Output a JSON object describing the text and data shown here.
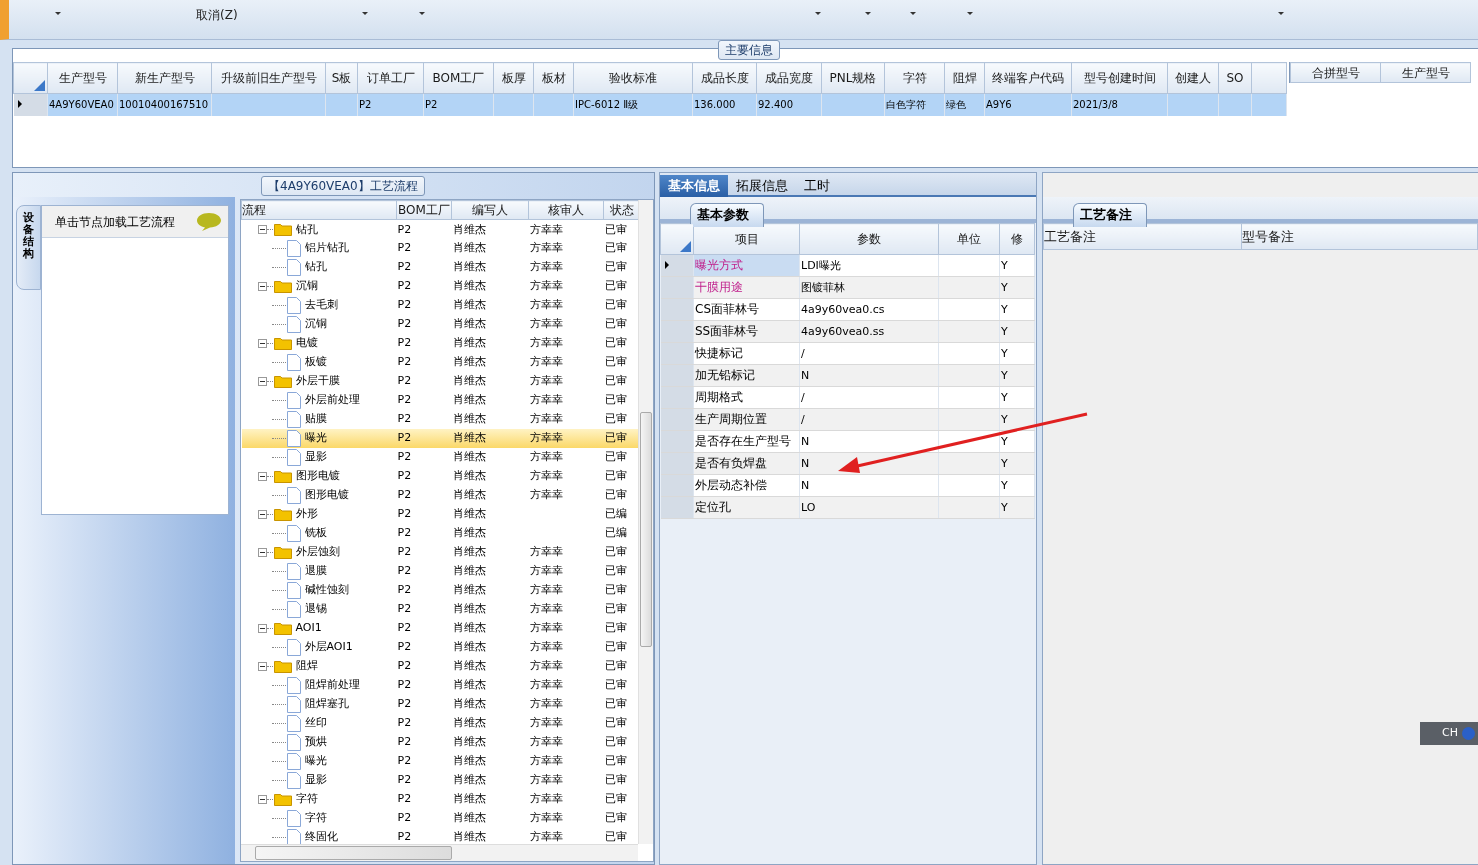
{
  "toolbar": {
    "items": [
      {
        "kind": "dropdown"
      },
      {
        "kind": "label",
        "text": "取消(Z)"
      },
      {
        "kind": "dropdown"
      },
      {
        "kind": "dropdown"
      },
      {
        "kind": "dropdown"
      },
      {
        "kind": "dropdown"
      },
      {
        "kind": "dropdown"
      },
      {
        "kind": "dropdown"
      },
      {
        "kind": "dropdown"
      }
    ]
  },
  "main_info": {
    "title": "主要信息",
    "columns": [
      "生产型号",
      "新生产型号",
      "升级前旧生产型号",
      "S板",
      "订单工厂",
      "BOM工厂",
      "板厚",
      "板材",
      "验收标准",
      "成品长度",
      "成品宽度",
      "PNL规格",
      "字符",
      "阻焊",
      "终端客户代码",
      "型号创建时间",
      "创建人",
      "SO"
    ],
    "rows": [
      {
        "selected": true,
        "cells": [
          "4A9Y60VEA0",
          "10010400167510",
          null,
          null,
          "P2",
          "P2",
          null,
          null,
          "IPC-6012 Ⅱ级",
          "136.000",
          "92.400",
          null,
          "白色字符",
          "绿色",
          "A9Y6",
          "2021/3/8",
          null,
          null
        ]
      }
    ],
    "merge_table": {
      "columns": [
        "合拼型号",
        "生产型号"
      ]
    }
  },
  "process": {
    "title": "【4A9Y60VEA0】工艺流程",
    "side_tab": "设备结构",
    "hint": "单击节点加载工艺流程",
    "columns": [
      "流程",
      "BOM工厂",
      "编写人",
      "核审人",
      "状态"
    ],
    "tree": [
      {
        "name": "钻孔",
        "factory": "P2",
        "writer": "肖维杰",
        "reviewer": "方幸幸",
        "status": "已审",
        "expanded": true,
        "selected": false,
        "children": [
          {
            "name": "铝片钻孔",
            "factory": "P2",
            "writer": "肖维杰",
            "reviewer": "方幸幸",
            "status": "已审",
            "selected": false
          },
          {
            "name": "钻孔",
            "factory": "P2",
            "writer": "肖维杰",
            "reviewer": "方幸幸",
            "status": "已审",
            "selected": false
          }
        ]
      },
      {
        "name": "沉铜",
        "factory": "P2",
        "writer": "肖维杰",
        "reviewer": "方幸幸",
        "status": "已审",
        "expanded": true,
        "selected": false,
        "children": [
          {
            "name": "去毛刺",
            "factory": "P2",
            "writer": "肖维杰",
            "reviewer": "方幸幸",
            "status": "已审",
            "selected": false
          },
          {
            "name": "沉铜",
            "factory": "P2",
            "writer": "肖维杰",
            "reviewer": "方幸幸",
            "status": "已审",
            "selected": false
          }
        ]
      },
      {
        "name": "电镀",
        "factory": "P2",
        "writer": "肖维杰",
        "reviewer": "方幸幸",
        "status": "已审",
        "expanded": true,
        "selected": false,
        "children": [
          {
            "name": "板镀",
            "factory": "P2",
            "writer": "肖维杰",
            "reviewer": "方幸幸",
            "status": "已审",
            "selected": false
          }
        ]
      },
      {
        "name": "外层干膜",
        "factory": "P2",
        "writer": "肖维杰",
        "reviewer": "方幸幸",
        "status": "已审",
        "expanded": true,
        "selected": false,
        "children": [
          {
            "name": "外层前处理",
            "factory": "P2",
            "writer": "肖维杰",
            "reviewer": "方幸幸",
            "status": "已审",
            "selected": false
          },
          {
            "name": "贴膜",
            "factory": "P2",
            "writer": "肖维杰",
            "reviewer": "方幸幸",
            "status": "已审",
            "selected": false
          },
          {
            "name": "曝光",
            "factory": "P2",
            "writer": "肖维杰",
            "reviewer": "方幸幸",
            "status": "已审",
            "selected": true
          },
          {
            "name": "显影",
            "factory": "P2",
            "writer": "肖维杰",
            "reviewer": "方幸幸",
            "status": "已审",
            "selected": false
          }
        ]
      },
      {
        "name": "图形电镀",
        "factory": "P2",
        "writer": "肖维杰",
        "reviewer": "方幸幸",
        "status": "已审",
        "expanded": true,
        "selected": false,
        "children": [
          {
            "name": "图形电镀",
            "factory": "P2",
            "writer": "肖维杰",
            "reviewer": "方幸幸",
            "status": "已审",
            "selected": false
          }
        ]
      },
      {
        "name": "外形",
        "factory": "P2",
        "writer": "肖维杰",
        "status": "已编",
        "expanded": true,
        "selected": false,
        "children": [
          {
            "name": "铣板",
            "factory": "P2",
            "writer": "肖维杰",
            "status": "已编",
            "selected": false
          }
        ]
      },
      {
        "name": "外层蚀刻",
        "factory": "P2",
        "writer": "肖维杰",
        "reviewer": "方幸幸",
        "status": "已审",
        "expanded": true,
        "selected": false,
        "children": [
          {
            "name": "退膜",
            "factory": "P2",
            "writer": "肖维杰",
            "reviewer": "方幸幸",
            "status": "已审",
            "selected": false
          },
          {
            "name": "碱性蚀刻",
            "factory": "P2",
            "writer": "肖维杰",
            "reviewer": "方幸幸",
            "status": "已审",
            "selected": false
          },
          {
            "name": "退锡",
            "factory": "P2",
            "writer": "肖维杰",
            "reviewer": "方幸幸",
            "status": "已审",
            "selected": false
          }
        ]
      },
      {
        "name": "AOI1",
        "factory": "P2",
        "writer": "肖维杰",
        "reviewer": "方幸幸",
        "status": "已审",
        "expanded": true,
        "selected": false,
        "children": [
          {
            "name": "外层AOI1",
            "factory": "P2",
            "writer": "肖维杰",
            "reviewer": "方幸幸",
            "status": "已审",
            "selected": false
          }
        ]
      },
      {
        "name": "阻焊",
        "factory": "P2",
        "writer": "肖维杰",
        "reviewer": "方幸幸",
        "status": "已审",
        "expanded": true,
        "selected": false,
        "children": [
          {
            "name": "阻焊前处理",
            "factory": "P2",
            "writer": "肖维杰",
            "reviewer": "方幸幸",
            "status": "已审",
            "selected": false
          },
          {
            "name": "阻焊塞孔",
            "factory": "P2",
            "writer": "肖维杰",
            "reviewer": "方幸幸",
            "status": "已审",
            "selected": false
          },
          {
            "name": "丝印",
            "factory": "P2",
            "writer": "肖维杰",
            "reviewer": "方幸幸",
            "status": "已审",
            "selected": false
          },
          {
            "name": "预烘",
            "factory": "P2",
            "writer": "肖维杰",
            "reviewer": "方幸幸",
            "status": "已审",
            "selected": false
          },
          {
            "name": "曝光",
            "factory": "P2",
            "writer": "肖维杰",
            "reviewer": "方幸幸",
            "status": "已审",
            "selected": false
          },
          {
            "name": "显影",
            "factory": "P2",
            "writer": "肖维杰",
            "reviewer": "方幸幸",
            "status": "已审",
            "selected": false
          }
        ]
      },
      {
        "name": "字符",
        "factory": "P2",
        "writer": "肖维杰",
        "reviewer": "方幸幸",
        "status": "已审",
        "expanded": true,
        "selected": false,
        "children": [
          {
            "name": "字符",
            "factory": "P2",
            "writer": "肖维杰",
            "reviewer": "方幸幸",
            "status": "已审",
            "selected": false
          },
          {
            "name": "终固化",
            "factory": "P2",
            "writer": "肖维杰",
            "reviewer": "方幸幸",
            "status": "已审",
            "selected": false
          }
        ]
      }
    ]
  },
  "detail": {
    "tabs": [
      {
        "label": "基本信息",
        "selected": true
      },
      {
        "label": "拓展信息",
        "selected": false
      },
      {
        "label": "工时",
        "selected": false
      }
    ],
    "sub_tab": "基本参数",
    "columns": [
      "项目",
      "参数",
      "单位",
      "修"
    ],
    "rows": [
      {
        "item": "曝光方式",
        "value": "LDI曝光",
        "modifiable": "Y",
        "highlighted": true,
        "selected": true
      },
      {
        "item": "干膜用途",
        "value": "图镀菲林",
        "modifiable": "Y",
        "highlighted": true,
        "selected": false
      },
      {
        "item": "CS面菲林号",
        "value": "4a9y60vea0.cs",
        "modifiable": "Y",
        "highlighted": false,
        "selected": false
      },
      {
        "item": "SS面菲林号",
        "value": "4a9y60vea0.ss",
        "modifiable": "Y",
        "highlighted": false,
        "selected": false
      },
      {
        "item": "快捷标记",
        "value": "/",
        "modifiable": "Y",
        "highlighted": false,
        "selected": false
      },
      {
        "item": "加无铅标记",
        "value": "N",
        "modifiable": "Y",
        "highlighted": false,
        "selected": false
      },
      {
        "item": "周期格式",
        "value": "/",
        "modifiable": "Y",
        "highlighted": false,
        "selected": false
      },
      {
        "item": "生产周期位置",
        "value": "/",
        "modifiable": "Y",
        "highlighted": false,
        "selected": false
      },
      {
        "item": "是否存在生产型号",
        "value": "N",
        "modifiable": "Y",
        "highlighted": false,
        "selected": false
      },
      {
        "item": "是否有负焊盘",
        "value": "N",
        "modifiable": "Y",
        "highlighted": false,
        "selected": false
      },
      {
        "item": "外层动态补偿",
        "value": "N",
        "modifiable": "Y",
        "highlighted": false,
        "selected": false
      },
      {
        "item": "定位孔",
        "value": "LO",
        "modifiable": "Y",
        "highlighted": false,
        "selected": false
      }
    ]
  },
  "notes": {
    "tab": "工艺备注",
    "columns": [
      "工艺备注",
      "型号备注"
    ]
  },
  "ime_bar": {
    "language": "CH"
  },
  "annotations": [
    {
      "kind": "arrow",
      "color": "#e02020"
    }
  ]
}
